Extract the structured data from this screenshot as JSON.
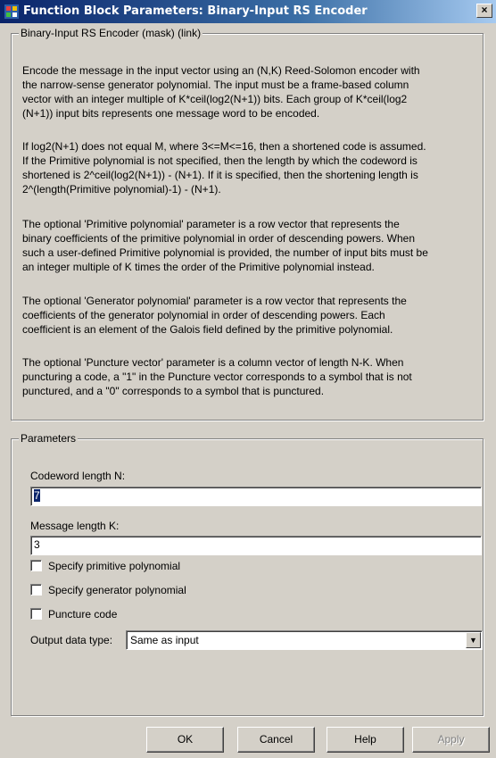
{
  "window": {
    "title": "Function Block Parameters: Binary-Input RS Encoder",
    "close_glyph": "×",
    "icon": "simulink-block-icon"
  },
  "description": {
    "group_title": "Binary-Input RS Encoder (mask) (link)",
    "p1_lines": [
      "Encode the message in the input vector using an (N,K) Reed-Solomon encoder with",
      "the narrow-sense generator polynomial.  The input must be a frame-based column",
      "vector with an integer multiple of K*ceil(log2(N+1)) bits.  Each group of K*ceil(log2",
      "(N+1)) input bits represents one message word to be encoded."
    ],
    "p2_lines": [
      "If log2(N+1) does not equal M, where 3<=M<=16, then a shortened code is assumed.",
      "If the Primitive polynomial is not specified, then the length by which the codeword is",
      "shortened is 2^ceil(log2(N+1)) - (N+1).  If it is specified, then the shortening length is",
      "2^(length(Primitive polynomial)-1) - (N+1)."
    ],
    "p3_lines": [
      "The optional 'Primitive polynomial' parameter is a row vector that represents the",
      "binary coefficients of the primitive polynomial in order of descending powers.  When",
      "such a user-defined Primitive polynomial is provided, the number of input bits must be",
      "an integer multiple of K times the order of the Primitive polynomial instead."
    ],
    "p4_lines": [
      "The optional 'Generator polynomial' parameter is a row vector that represents the",
      "coefficients of the generator polynomial in order of descending powers.  Each",
      "coefficient is an element of the Galois field defined by the primitive polynomial."
    ],
    "p5_lines": [
      "The optional 'Puncture vector' parameter is a column vector of length N-K.  When",
      "puncturing a code, a \"1\" in the Puncture vector corresponds to a symbol that is not",
      "punctured, and a \"0\" corresponds to a symbol that is punctured."
    ]
  },
  "parameters": {
    "group_title": "Parameters",
    "codeword_label": "Codeword length N:",
    "codeword_value": "7",
    "message_label": "Message length K:",
    "message_value": "3",
    "checkboxes": [
      {
        "label": "Specify primitive polynomial",
        "checked": false
      },
      {
        "label": "Specify generator polynomial",
        "checked": false
      },
      {
        "label": "Puncture code",
        "checked": false
      }
    ],
    "output_type_label": "Output data type:",
    "output_type_value": "Same as input",
    "dropdown_arrow": "▼"
  },
  "buttons": {
    "ok": "OK",
    "cancel": "Cancel",
    "help": "Help",
    "apply": "Apply"
  }
}
